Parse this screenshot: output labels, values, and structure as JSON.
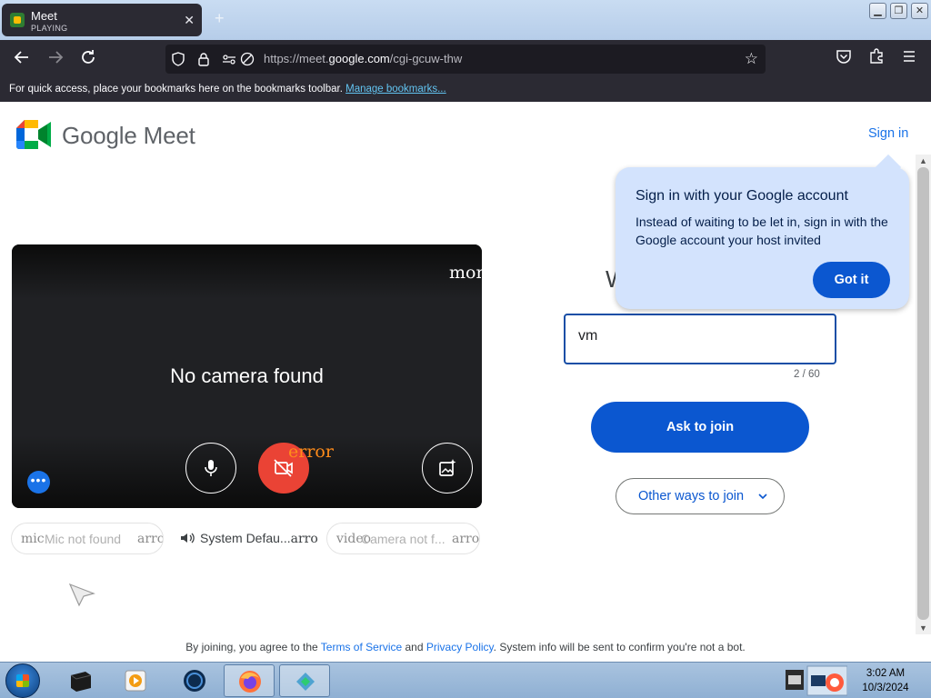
{
  "browser": {
    "tab": {
      "title": "Meet",
      "subtitle": "PLAYING",
      "close": "✕"
    },
    "new_tab": "+",
    "url": {
      "prefix": "https://meet.",
      "domain": "google.com",
      "path": "/cgi-gcuw-thw"
    },
    "bookmarks": {
      "text": "For quick access, place your bookmarks here on the bookmarks toolbar.",
      "link": "Manage bookmarks..."
    }
  },
  "meet": {
    "logo_text": "Google Meet",
    "sign_in": "Sign in",
    "video": {
      "no_camera": "No camera found",
      "overlay_top": "mon",
      "overlay_error": "error",
      "more": "•••"
    },
    "devices": {
      "mic_overlay": "mic",
      "mic_label": "Mic not found",
      "mic_arrow": "arro",
      "speaker_label": "System Defau...",
      "speaker_arrow": "arro",
      "video_overlay": "video",
      "video_label": "Camera not f...",
      "video_arrow": "arro"
    },
    "heading_partial": "W",
    "name_value": "vm",
    "char_count": "2 / 60",
    "ask_to_join": "Ask to join",
    "other_ways": "Other ways to join",
    "tooltip": {
      "title": "Sign in with your Google account",
      "body": "Instead of waiting to be let in, sign in with the Google account your host invited",
      "button": "Got it"
    },
    "footer": {
      "pre": "By joining, you agree to the ",
      "terms": "Terms of Service",
      "and": " and ",
      "privacy": "Privacy Policy",
      "post": ". System info will be sent to confirm you're not a bot."
    }
  },
  "taskbar": {
    "time": "3:02 AM",
    "date": "10/3/2024"
  }
}
